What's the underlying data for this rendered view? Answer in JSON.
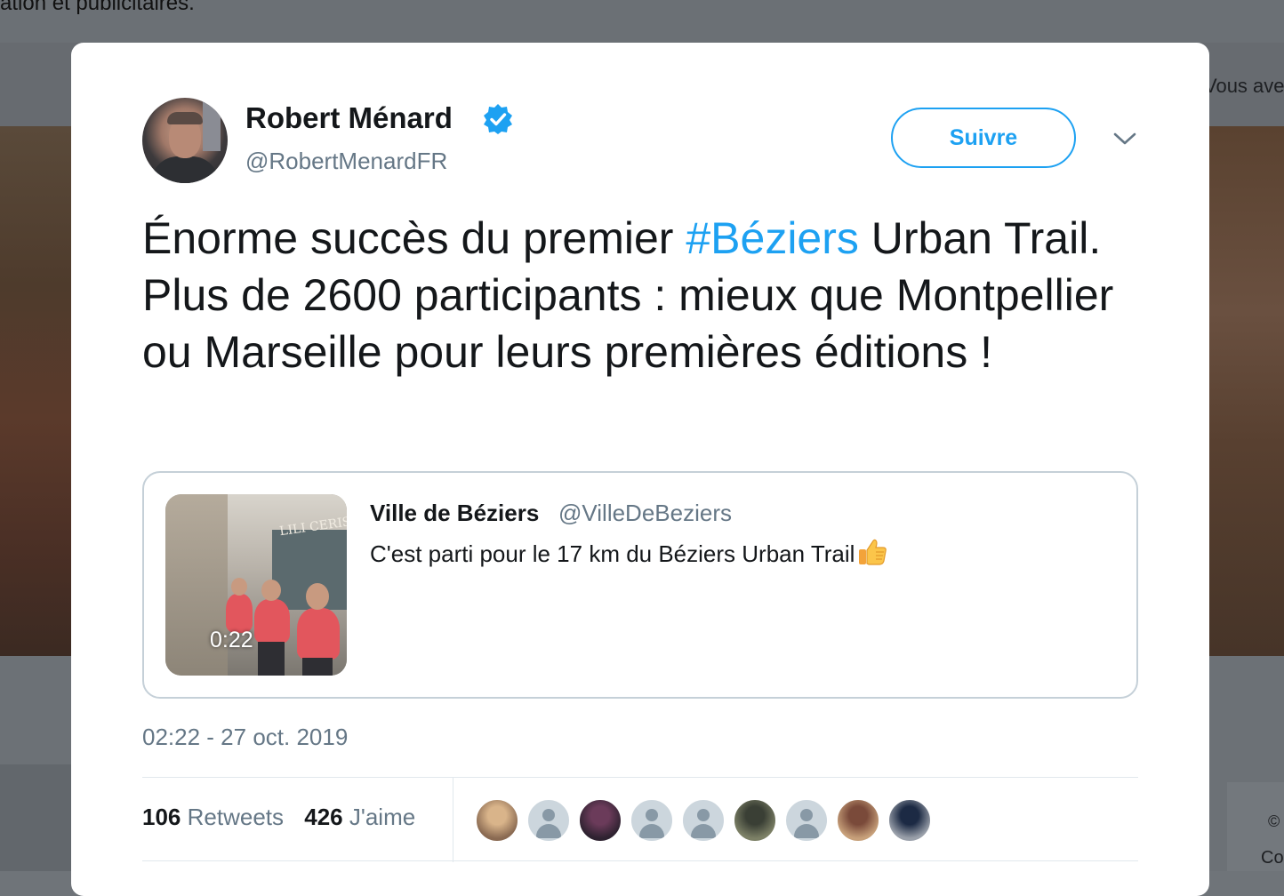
{
  "background": {
    "notice_text": "ation et publicitaires.",
    "right_text": "Vous ave",
    "right_glyph_1": "©",
    "right_glyph_2": "Co"
  },
  "tweet": {
    "author": {
      "name": "Robert Ménard",
      "handle": "@RobertMenardFR",
      "verified": true
    },
    "follow_label": "Suivre",
    "text_before": "Énorme succès du premier ",
    "hashtag": "#Béziers",
    "text_after": " Urban Trail. Plus de 2600 participants : mieux que Montpellier ou Marseille pour leurs premières éditions !",
    "quoted": {
      "author": "Ville de Béziers",
      "handle": "@VilleDeBeziers",
      "text": "C'est parti pour le 17 km du Béziers Urban Trail",
      "emoji_icon": "thumbs-up-icon",
      "video_duration": "0:22",
      "thumb_sign": "LILI CERISE"
    },
    "timestamp": "02:22 - 27 oct. 2019",
    "stats": {
      "retweets_count": "106",
      "retweets_label": "Retweets",
      "likes_count": "426",
      "likes_label": "J'aime"
    },
    "liker_avatars": [
      {
        "kind": "photo",
        "colors": [
          "#d9b48a",
          "#8a6a52"
        ]
      },
      {
        "kind": "placeholder"
      },
      {
        "kind": "photo",
        "colors": [
          "#6b3b5a",
          "#2e2230"
        ]
      },
      {
        "kind": "placeholder"
      },
      {
        "kind": "placeholder"
      },
      {
        "kind": "photo",
        "colors": [
          "#3a3f35",
          "#7c8066"
        ]
      },
      {
        "kind": "placeholder"
      },
      {
        "kind": "photo",
        "colors": [
          "#7a4a3a",
          "#c7a07a"
        ]
      },
      {
        "kind": "photo",
        "colors": [
          "#1c2a44",
          "#9aa0aa"
        ]
      }
    ]
  },
  "colors": {
    "accent": "#1da1f2",
    "muted_text": "#657786",
    "border": "#c5d0d8"
  }
}
